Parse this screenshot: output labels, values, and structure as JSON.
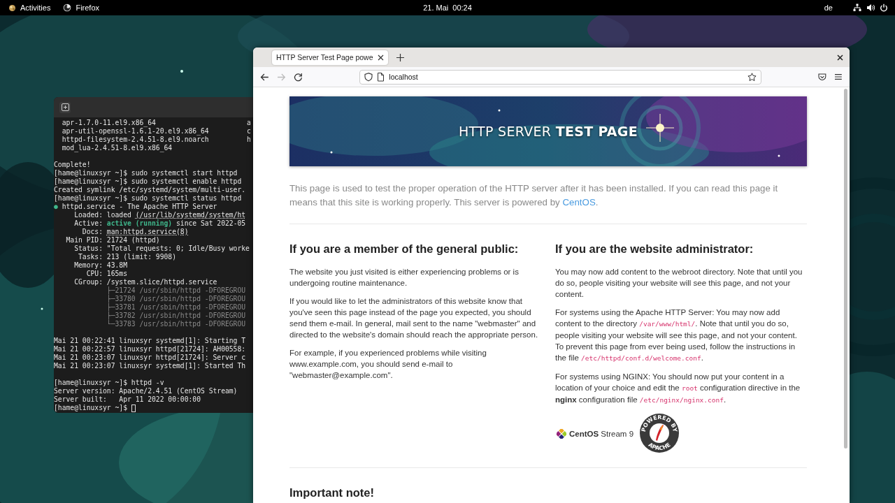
{
  "top_bar": {
    "activities": "Activities",
    "app": "Firefox",
    "clock": "21. Mai  00:24",
    "keyboard_layout": "de"
  },
  "terminal": {
    "cursor": true,
    "blocks": [
      [
        {
          "segments": [
            {
              "text": "  apr-1.7.0-11.el9.x86_64",
              "kind": "normal"
            },
            {
              "text": "a",
              "kind": "col2"
            }
          ]
        },
        {
          "segments": [
            {
              "text": "  apr-util-openssl-1.6.1-20.el9.x86_64",
              "kind": "normal"
            },
            {
              "text": "c",
              "kind": "col2"
            }
          ]
        },
        {
          "segments": [
            {
              "text": "  httpd-filesystem-2.4.51-8.el9.noarch",
              "kind": "normal"
            },
            {
              "text": "h",
              "kind": "col2"
            }
          ]
        },
        {
          "segments": [
            {
              "text": "  mod_lua-2.4.51-8.el9.x86_64",
              "kind": "normal"
            }
          ]
        }
      ],
      [
        {
          "segments": [
            {
              "text": "Complete!",
              "kind": "normal"
            }
          ]
        },
        {
          "segments": [
            {
              "text": "[hame@linuxsyr ~]$ sudo systemctl start httpd",
              "kind": "normal"
            }
          ]
        },
        {
          "segments": [
            {
              "text": "[hame@linuxsyr ~]$ sudo systemctl enable httpd",
              "kind": "normal"
            }
          ]
        },
        {
          "segments": [
            {
              "text": "Created symlink /etc/systemd/system/multi-user.",
              "kind": "normal"
            }
          ]
        },
        {
          "segments": [
            {
              "text": "[hame@linuxsyr ~]$ sudo systemctl status httpd",
              "kind": "normal"
            }
          ]
        },
        {
          "segments": [
            {
              "text": "●",
              "kind": "green"
            },
            {
              "text": " httpd.service - The Apache HTTP Server",
              "kind": "normal"
            }
          ]
        },
        {
          "segments": [
            {
              "text": "     Loaded: loaded ",
              "kind": "normal"
            },
            {
              "text": "(/usr/lib/systemd/system/ht",
              "kind": "link"
            }
          ]
        },
        {
          "segments": [
            {
              "text": "     Active: ",
              "kind": "normal"
            },
            {
              "text": "active (running)",
              "kind": "green"
            },
            {
              "text": " since Sat 2022-05",
              "kind": "normal"
            }
          ]
        },
        {
          "segments": [
            {
              "text": "       Docs: ",
              "kind": "normal"
            },
            {
              "text": "man:httpd.service(8)",
              "kind": "link"
            }
          ]
        },
        {
          "segments": [
            {
              "text": "   Main PID: 21724 (httpd)",
              "kind": "normal"
            }
          ]
        },
        {
          "segments": [
            {
              "text": "     Status: \"Total requests: 0; Idle/Busy worke",
              "kind": "normal"
            }
          ]
        },
        {
          "segments": [
            {
              "text": "      Tasks: 213 (limit: 9908)",
              "kind": "normal"
            }
          ]
        },
        {
          "segments": [
            {
              "text": "     Memory: 43.8M",
              "kind": "normal"
            }
          ]
        },
        {
          "segments": [
            {
              "text": "        CPU: 165ms",
              "kind": "normal"
            }
          ]
        },
        {
          "segments": [
            {
              "text": "     CGroup: /system.slice/httpd.service",
              "kind": "normal"
            }
          ]
        },
        {
          "segments": [
            {
              "text": "             ├─21724 /usr/sbin/httpd -DFOREGROU",
              "kind": "dim"
            }
          ]
        },
        {
          "segments": [
            {
              "text": "             ├─33780 /usr/sbin/httpd -DFOREGROU",
              "kind": "dim"
            }
          ]
        },
        {
          "segments": [
            {
              "text": "             ├─33781 /usr/sbin/httpd -DFOREGROU",
              "kind": "dim"
            }
          ]
        },
        {
          "segments": [
            {
              "text": "             ├─33782 /usr/sbin/httpd -DFOREGROU",
              "kind": "dim"
            }
          ]
        },
        {
          "segments": [
            {
              "text": "             └─33783 /usr/sbin/httpd -DFOREGROU",
              "kind": "dim"
            }
          ]
        }
      ],
      [
        {
          "segments": [
            {
              "text": "Mai 21 00:22:41 linuxsyr systemd[1]: Starting T",
              "kind": "normal"
            }
          ]
        },
        {
          "segments": [
            {
              "text": "Mai 21 00:22:57 linuxsyr httpd[21724]: AH00558:",
              "kind": "normal"
            }
          ]
        },
        {
          "segments": [
            {
              "text": "Mai 21 00:23:07 linuxsyr httpd[21724]: Server c",
              "kind": "normal"
            }
          ]
        },
        {
          "segments": [
            {
              "text": "Mai 21 00:23:07 linuxsyr systemd[1]: Started Th",
              "kind": "normal"
            }
          ]
        }
      ],
      [
        {
          "segments": [
            {
              "text": "[hame@linuxsyr ~]$ httpd -v",
              "kind": "normal"
            }
          ]
        },
        {
          "segments": [
            {
              "text": "Server version: Apache/2.4.51 (CentOS Stream)",
              "kind": "normal"
            }
          ]
        },
        {
          "segments": [
            {
              "text": "Server built:   Apr 11 2022 00:00:00",
              "kind": "normal"
            }
          ]
        },
        {
          "segments": [
            {
              "text": "[hame@linuxsyr ~]$ ",
              "kind": "normal"
            }
          ]
        }
      ]
    ]
  },
  "browser": {
    "tabs": [
      {
        "title": "HTTP Server Test Page powe",
        "selected": true
      }
    ],
    "back_disabled": false,
    "forward_disabled": true,
    "address": "localhost"
  },
  "page": {
    "banner_title": "HTTP SERVER **TEST PAGE**",
    "intro": [
      {
        "text": "This page is used to test the proper operation of the HTTP server after it has been installed. If you can read this page it means that this site is working properly. This server is powered by ",
        "kind": "text"
      },
      {
        "text": "CentOS",
        "kind": "link"
      },
      {
        "text": ".",
        "kind": "text"
      }
    ],
    "columns": [
      {
        "heading": "If you are a member of the general public:",
        "paragraphs": [
          [
            {
              "text": "The website you just visited is either experiencing problems or is undergoing routine maintenance.",
              "kind": "text"
            }
          ],
          [
            {
              "text": "If you would like to let the administrators of this website know that you've seen this page instead of the page you expected, you should send them e-mail. In general, mail sent to the name \"webmaster\" and directed to the website's domain should reach the appropriate person.",
              "kind": "text"
            }
          ],
          [
            {
              "text": "For example, if you experienced problems while visiting www.example.com, you should send e-mail to \"webmaster@example.com\".",
              "kind": "text"
            }
          ]
        ]
      },
      {
        "heading": "If you are the website administrator:",
        "paragraphs": [
          [
            {
              "text": "You may now add content to the webroot directory. Note that until you do so, people visiting your website will see this page, and not your content.",
              "kind": "text"
            }
          ],
          [
            {
              "text": "For systems using the Apache HTTP Server: You may now add content to the directory ",
              "kind": "text"
            },
            {
              "text": "/var/www/html/",
              "kind": "code"
            },
            {
              "text": ". Note that until you do so, people visiting your website will see this page, and not your content. To prevent this page from ever being used, follow the instructions in the file ",
              "kind": "text"
            },
            {
              "text": "/etc/httpd/conf.d/welcome.conf",
              "kind": "code"
            },
            {
              "text": ".",
              "kind": "text"
            }
          ],
          [
            {
              "text": "For systems using NGINX: You should now put your content in a location of your choice and edit the ",
              "kind": "text"
            },
            {
              "text": "root",
              "kind": "code"
            },
            {
              "text": " configuration directive in the ",
              "kind": "text"
            },
            {
              "text": "nginx",
              "kind": "bold"
            },
            {
              "text": " configuration file ",
              "kind": "text"
            },
            {
              "text": "/etc/nginx/nginx.conf",
              "kind": "code"
            },
            {
              "text": ".",
              "kind": "text"
            }
          ]
        ],
        "logos": {
          "centos": "**CentOS** Stream 9",
          "badge_top": "POWERED BY",
          "badge_bottom": "APACHE"
        }
      }
    ],
    "next_heading": "Important note!"
  }
}
